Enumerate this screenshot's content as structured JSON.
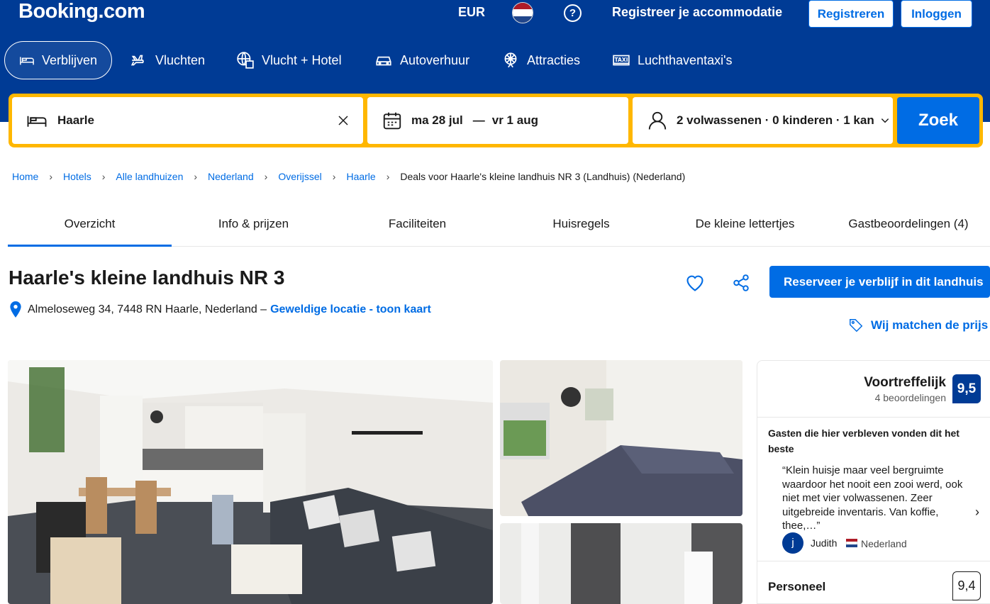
{
  "header": {
    "logo": "Booking.com",
    "currency": "EUR",
    "help": "?",
    "register_property": "Registreer je accommodatie",
    "register_button": "Registreren",
    "login_button": "Inloggen",
    "flag_colors": [
      "#ae1c28",
      "#ffffff",
      "#21468b"
    ]
  },
  "nav": [
    {
      "label": "Verblijven",
      "icon": "bed-icon"
    },
    {
      "label": "Vluchten",
      "icon": "plane-icon"
    },
    {
      "label": "Vlucht + Hotel",
      "icon": "globe-plane-icon"
    },
    {
      "label": "Autoverhuur",
      "icon": "car-icon"
    },
    {
      "label": "Attracties",
      "icon": "attraction-icon"
    },
    {
      "label": "Luchthaventaxi's",
      "icon": "taxi-icon"
    }
  ],
  "search": {
    "destination": "Haarle",
    "checkin": "ma 28 jul",
    "dash": "—",
    "checkout": "vr 1 aug",
    "guests": "2 volwassenen · 0 kinderen · 1 kan",
    "button": "Zoek"
  },
  "breadcrumb": [
    "Home",
    "Hotels",
    "Alle landhuizen",
    "Nederland",
    "Overijssel",
    "Haarle"
  ],
  "breadcrumb_current": "Deals voor Haarle's kleine landhuis NR 3 (Landhuis) (Nederland)",
  "tabs": [
    "Overzicht",
    "Info & prijzen",
    "Faciliteiten",
    "Huisregels",
    "De kleine lettertjes",
    "Gastbeoordelingen (4)"
  ],
  "property": {
    "title": "Haarle's kleine landhuis NR 3",
    "address": "Almeloseweg 34, 7448 RN Haarle, Nederland –",
    "location_link": "Geweldige locatie - toon kaart",
    "reserve_button": "Reserveer je verblijf in dit landhuis",
    "price_match": "Wij matchen de prijs"
  },
  "review": {
    "rating_word": "Voortreffelijk",
    "rating_count": "4 beoordelingen",
    "score": "9,5",
    "best_heading": "Gasten die hier verbleven vonden dit het beste",
    "quote": "“Klein huisje maar veel bergruimte waardoor het nooit een zooi werd, ook niet met vier volwassenen. Zeer uitgebreide inventaris. Van koffie, thee,…”",
    "reviewer_initial": "j",
    "reviewer": "Judith",
    "country": "Nederland",
    "staff_label": "Personeel",
    "staff_score": "9,4"
  },
  "colors": {
    "brand_dark": "#003b95",
    "brand_blue": "#006ce4",
    "search_yellow": "#ffb700"
  }
}
